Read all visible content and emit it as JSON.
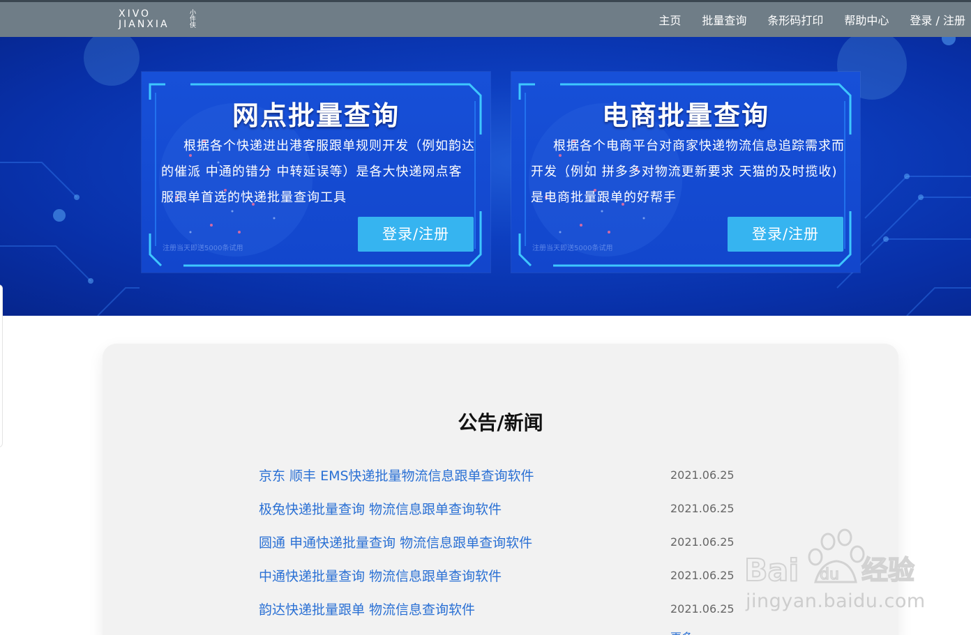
{
  "brand": {
    "logo_line1": "XIVO",
    "logo_line2": "JIANXIA",
    "logo_cn": "小件侠"
  },
  "nav": {
    "items": [
      "主页",
      "批量查询",
      "条形码打印",
      "帮助中心",
      "登录 / 注册"
    ]
  },
  "cards": [
    {
      "title": "网点批量查询",
      "description": "根据各个快递进出港客服跟单规则开发（例如韵达的催派 中通的错分 中转延误等）是各大快递网点客服跟单首选的快递批量查询工具",
      "button": "登录/注册",
      "note": "注册当天即送5000条试用"
    },
    {
      "title": "电商批量查询",
      "description": "根据各个电商平台对商家快递物流信息追踪需求而开发（例如 拼多多对物流更新要求 天猫的及时揽收)是电商批量跟单的好帮手",
      "button": "登录/注册",
      "note": "注册当天即送5000条试用"
    }
  ],
  "news": {
    "title": "公告/新闻",
    "items": [
      {
        "title": "京东 顺丰 EMS快递批量物流信息跟单查询软件",
        "date": "2021.06.25"
      },
      {
        "title": "极兔快递批量查询 物流信息跟单查询软件",
        "date": "2021.06.25"
      },
      {
        "title": "圆通 申通快递批量查询 物流信息跟单查询软件",
        "date": "2021.06.25"
      },
      {
        "title": "中通快递批量查询 物流信息跟单查询软件",
        "date": "2021.06.25"
      },
      {
        "title": "韵达快递批量跟单 物流信息查询软件",
        "date": "2021.06.25"
      }
    ],
    "more": "更多"
  },
  "watermark": {
    "text": "jingyan.baidu.com",
    "logo": "Bai du 经验"
  }
}
